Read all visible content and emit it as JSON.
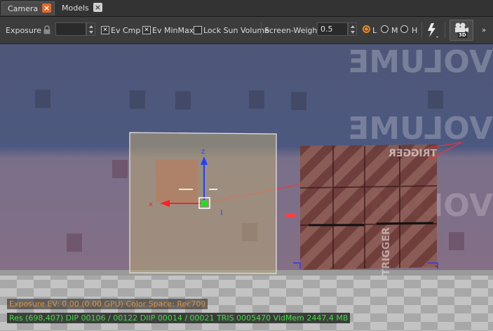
{
  "tabs": [
    {
      "label": "Camera",
      "active": true
    },
    {
      "label": "Models",
      "active": false
    }
  ],
  "toolbar": {
    "exposure_label": "Exposure",
    "exposure_value": "",
    "ev_cmp_label": "Ev Cmp",
    "ev_cmp_checked": true,
    "ev_minmax_label": "Ev MinMax",
    "ev_minmax_checked": true,
    "lock_sun_label": "Lock Sun Volume",
    "lock_sun_checked": false,
    "screen_weight_label": "Screen-Weight",
    "screen_weight_value": "0.5",
    "lod_options": [
      "L",
      "M",
      "H"
    ],
    "lod_selected": "L",
    "render_mode_badge": "3D"
  },
  "viewport": {
    "banner_text": "VOLUME",
    "trigger_text": "TRIGGER",
    "gizmo_axes": {
      "z": "z",
      "x": "x"
    }
  },
  "status": {
    "exposure_line": "Exposure EV: 0.00 (0.00 GPU)  Color Space: Rec709",
    "stats_line": "Res (698,407)   DIP 00106 / 00122  DIIP 00014 / 00021  TRIS 0005470  VidMem 2447.4 MB"
  },
  "colors": {
    "accent": "#e26a2c",
    "exposure_text": "#e8902c",
    "stats_text": "#3ee23e",
    "gizmo_z": "#1f3fff",
    "gizmo_x": "#ff2020",
    "gizmo_center": "#22dd22"
  }
}
